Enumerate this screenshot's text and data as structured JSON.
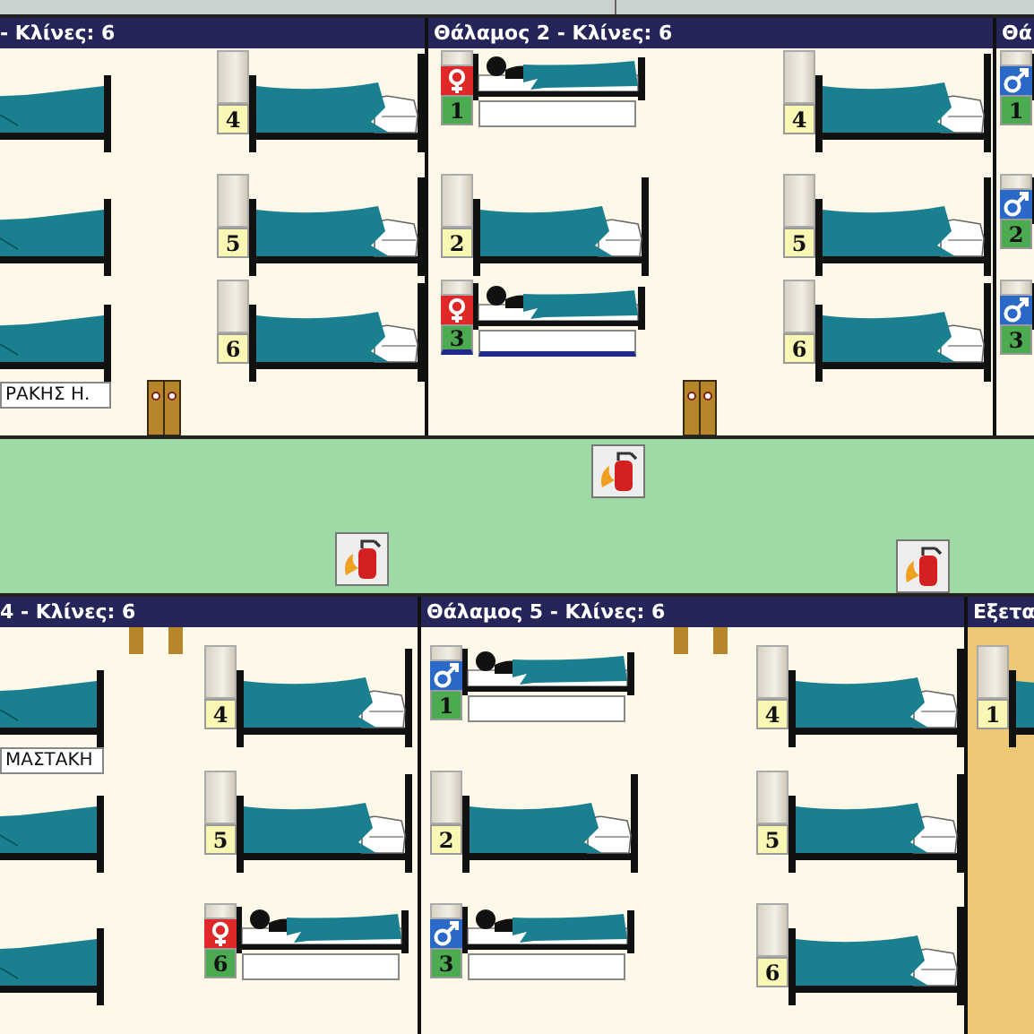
{
  "top_rooms": [
    {
      "title": "- Κλίνες: 6",
      "kind": "cut_west",
      "door": {
        "kind": "closed"
      },
      "left_beds": [
        {
          "kind": "cut",
          "selected": false
        },
        {
          "kind": "cut",
          "selected": false
        },
        {
          "kind": "cut",
          "name": "ΡΑΚΗΣ Η.",
          "selected": false
        }
      ],
      "right_beds": [
        {
          "kind": "empty",
          "number": "4",
          "selected": false
        },
        {
          "kind": "empty",
          "number": "5",
          "selected": false
        },
        {
          "kind": "empty",
          "number": "6",
          "selected": false
        }
      ]
    },
    {
      "title": "Θάλαμος 2 - Κλίνες: 6",
      "kind": "full",
      "door": {
        "kind": "closed"
      },
      "left_beds": [
        {
          "kind": "occupied",
          "number": "1",
          "female": true,
          "selected": false
        },
        {
          "kind": "empty",
          "number": "2",
          "selected": false
        },
        {
          "kind": "occupied",
          "number": "3",
          "female": true,
          "selected": true
        }
      ],
      "right_beds": [
        {
          "kind": "empty",
          "number": "4",
          "selected": false
        },
        {
          "kind": "empty",
          "number": "5",
          "selected": false
        },
        {
          "kind": "empty",
          "number": "6",
          "selected": false
        }
      ]
    },
    {
      "title": "Θά",
      "kind": "cut_east",
      "left_beds": [
        {
          "kind": "occupied",
          "number": "1",
          "female": false,
          "selected": false
        },
        {
          "kind": "occupied",
          "number": "2",
          "female": false,
          "selected": false
        },
        {
          "kind": "occupied",
          "number": "3",
          "female": false,
          "selected": false
        }
      ]
    }
  ],
  "bottom_rooms": [
    {
      "title": "4 - Κλίνες: 6",
      "kind": "cut_west",
      "door": {
        "kind": "open"
      },
      "left_beds": [
        {
          "kind": "cut",
          "name": "ΜΑΣΤΑΚΗ",
          "selected": false
        },
        {
          "kind": "cut",
          "selected": false
        },
        {
          "kind": "cut",
          "selected": false
        }
      ],
      "right_beds": [
        {
          "kind": "empty",
          "number": "4",
          "selected": false
        },
        {
          "kind": "empty",
          "number": "5",
          "selected": false
        },
        {
          "kind": "occupied",
          "number": "6",
          "female": true,
          "selected": false
        }
      ]
    },
    {
      "title": "Θάλαμος 5 - Κλίνες: 6",
      "kind": "full",
      "door": {
        "kind": "open"
      },
      "left_beds": [
        {
          "kind": "occupied",
          "number": "1",
          "female": false,
          "selected": false
        },
        {
          "kind": "empty",
          "number": "2",
          "selected": false
        },
        {
          "kind": "occupied",
          "number": "3",
          "female": false,
          "selected": false
        }
      ],
      "right_beds": [
        {
          "kind": "empty",
          "number": "4",
          "selected": false
        },
        {
          "kind": "empty",
          "number": "5",
          "selected": false
        },
        {
          "kind": "empty",
          "number": "6",
          "selected": false
        }
      ]
    },
    {
      "title": "Εξετα",
      "kind": "exam",
      "left_beds": [
        {
          "kind": "empty_cut",
          "number": "1",
          "selected": false
        }
      ]
    }
  ]
}
